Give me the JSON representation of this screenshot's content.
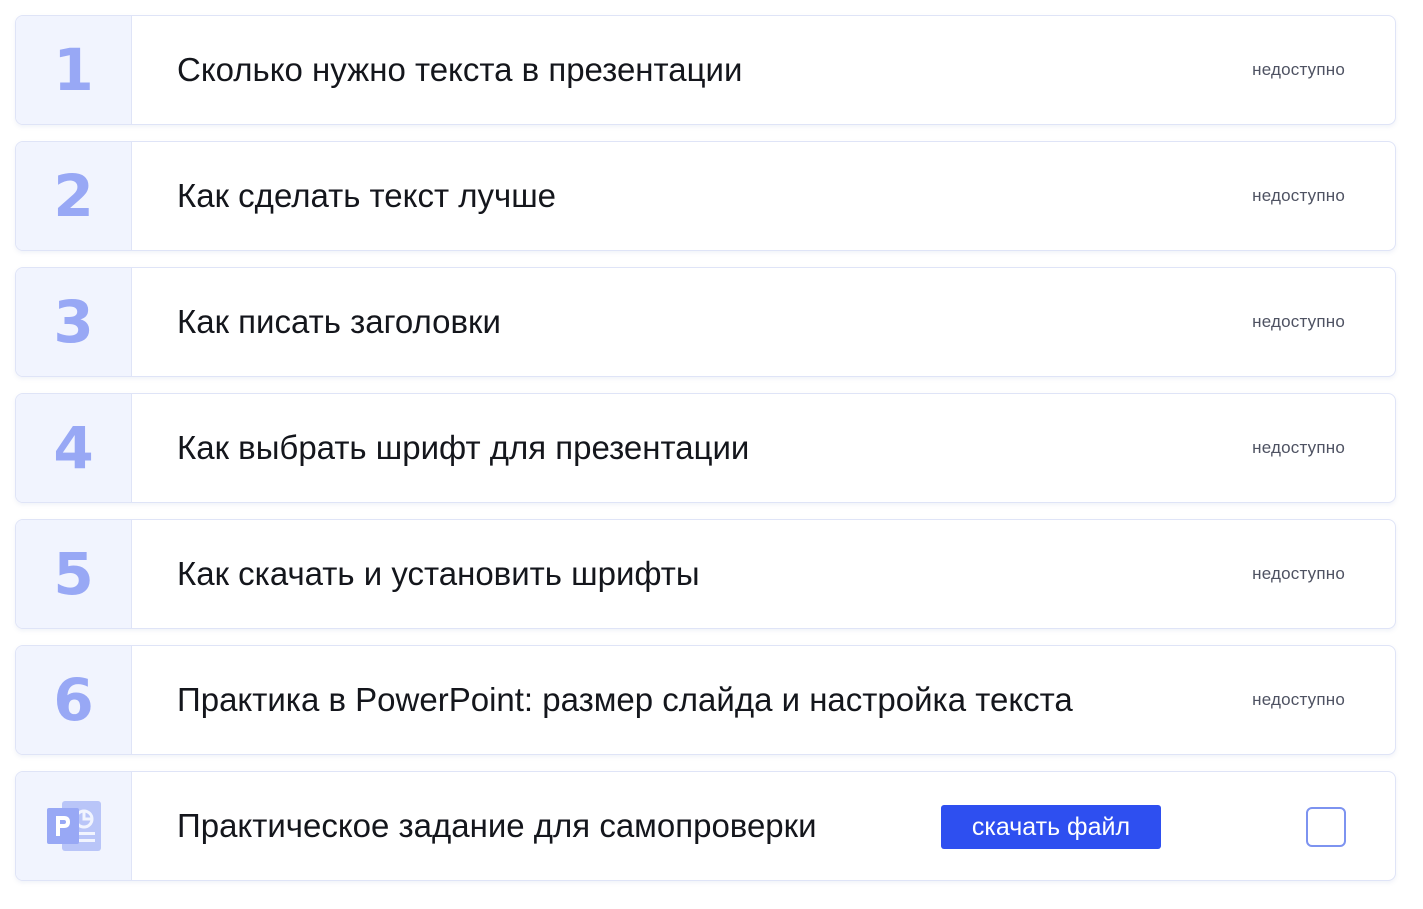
{
  "lessons": [
    {
      "number": "1",
      "title": "Сколько нужно текста в презентации",
      "status": "недоступно"
    },
    {
      "number": "2",
      "title": "Как сделать текст лучше",
      "status": "недоступно"
    },
    {
      "number": "3",
      "title": "Как писать заголовки",
      "status": "недоступно"
    },
    {
      "number": "4",
      "title": "Как выбрать шрифт для презентации",
      "status": "недоступно"
    },
    {
      "number": "5",
      "title": "Как скачать и установить шрифты",
      "status": "недоступно"
    },
    {
      "number": "6",
      "title": "Практика в PowerPoint: размер слайда и настройка текста",
      "status": "недоступно"
    }
  ],
  "task": {
    "icon": "powerpoint-file-icon",
    "title": "Практическое задание для самопроверки",
    "download_label": "скачать файл",
    "checked": false
  },
  "colors": {
    "accent": "#2e4ff0",
    "number": "#98a8f5",
    "number_cell_bg": "#f1f4fe",
    "border": "#dfe4f7",
    "checkbox_border": "#7d93f0"
  }
}
